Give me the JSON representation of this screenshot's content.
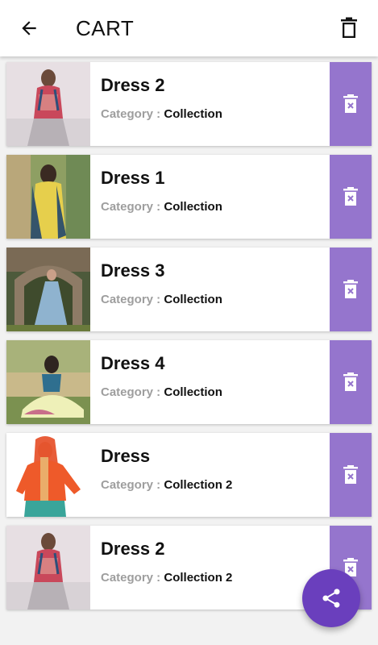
{
  "appbar": {
    "title": "CART",
    "back_icon": "arrow-back-icon",
    "clear_icon": "trash-icon"
  },
  "category_label": "Category : ",
  "items": [
    {
      "name": "Dress 2",
      "category": "Collection",
      "thumb": "woman-kurti-standing"
    },
    {
      "name": "Dress 1",
      "category": "Collection",
      "thumb": "woman-yellow-dupatta"
    },
    {
      "name": "Dress 3",
      "category": "Collection",
      "thumb": "woman-blue-gown-arch"
    },
    {
      "name": "Dress 4",
      "category": "Collection",
      "thumb": "woman-sitting-field"
    },
    {
      "name": "Dress",
      "category": "Collection 2",
      "thumb": "woman-orange-top"
    },
    {
      "name": "Dress 2",
      "category": "Collection 2",
      "thumb": "woman-kurti-standing"
    }
  ],
  "colors": {
    "delete_bg": "#9575cd",
    "fab_bg": "#6a3fbd"
  },
  "fab": {
    "icon": "share-icon"
  }
}
